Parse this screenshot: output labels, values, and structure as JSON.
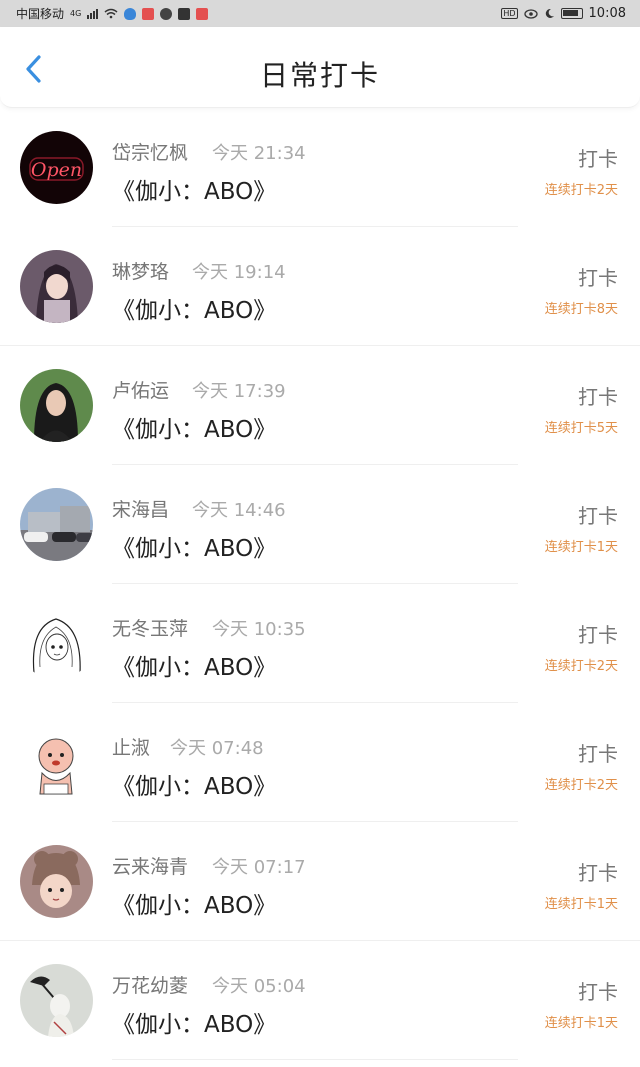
{
  "status_bar": {
    "carrier": "中国移动",
    "network": "4G",
    "time": "10:08",
    "hd": "HD"
  },
  "header": {
    "title": "日常打卡",
    "back_icon": "chevron-left-icon",
    "accent_color": "#3a8fe0"
  },
  "checkins": [
    {
      "name": "岱宗忆枫",
      "time": "今天 21:34",
      "title": "《伽小：ABO》",
      "action": "打卡",
      "streak": "连续打卡2天",
      "avatar": "neon-open-sign"
    },
    {
      "name": "琳梦珞",
      "time": "今天 19:14",
      "title": "《伽小：ABO》",
      "action": "打卡",
      "streak": "连续打卡8天",
      "avatar": "anime-girl"
    },
    {
      "name": "卢佑运",
      "time": "今天 17:39",
      "title": "《伽小：ABO》",
      "action": "打卡",
      "streak": "连续打卡5天",
      "avatar": "girl-portrait"
    },
    {
      "name": "宋海昌",
      "time": "今天 14:46",
      "title": "《伽小：ABO》",
      "action": "打卡",
      "streak": "连续打卡1天",
      "avatar": "cars-street"
    },
    {
      "name": "无冬玉萍",
      "time": "今天 10:35",
      "title": "《伽小：ABO》",
      "action": "打卡",
      "streak": "连续打卡2天",
      "avatar": "manga-sketch"
    },
    {
      "name": "止淑",
      "time": "今天 07:48",
      "title": "《伽小：ABO》",
      "action": "打卡",
      "streak": "连续打卡2天",
      "avatar": "cartoon-baby"
    },
    {
      "name": "云来海青",
      "time": "今天 07:17",
      "title": "《伽小：ABO》",
      "action": "打卡",
      "streak": "连续打卡1天",
      "avatar": "child-knit-hat"
    },
    {
      "name": "万花幼菱",
      "time": "今天 05:04",
      "title": "《伽小：ABO》",
      "action": "打卡",
      "streak": "连续打卡1天",
      "avatar": "anime-bird"
    }
  ],
  "colors": {
    "streak": "#e0904a",
    "name": "#777777",
    "time": "#aaaaaa"
  }
}
